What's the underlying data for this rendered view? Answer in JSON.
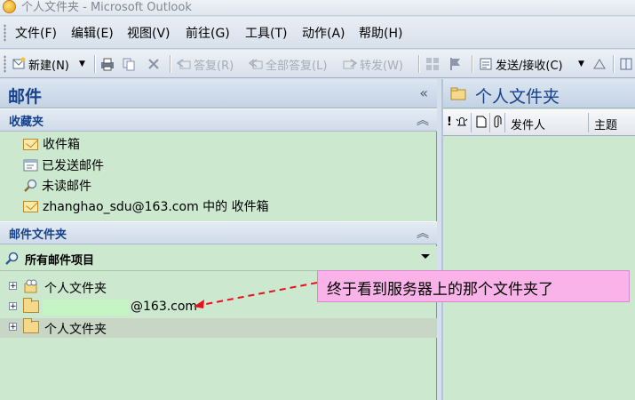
{
  "window": {
    "title": "个人文件夹 - Microsoft Outlook"
  },
  "menu": [
    "文件(F)",
    "编辑(E)",
    "视图(V)",
    "前往(G)",
    "工具(T)",
    "动作(A)",
    "帮助(H)"
  ],
  "toolbar": {
    "new": "新建(N)",
    "reply": "答复(R)",
    "reply_all": "全部答复(L)",
    "forward": "转发(W)",
    "send_receive": "发送/接收(C)"
  },
  "left_pane": {
    "title": "邮件",
    "favorites_title": "收藏夹",
    "favorites": [
      "收件箱",
      "已发送邮件",
      "未读邮件",
      "zhanghao_sdu@163.com 中的 收件箱"
    ],
    "mail_folders_title": "邮件文件夹",
    "all_items": "所有邮件项目",
    "tree": [
      "个人文件夹",
      "@163.com",
      "个人文件夹"
    ]
  },
  "right_pane": {
    "title": "个人文件夹",
    "columns": [
      "!",
      "发件人",
      "主题"
    ]
  },
  "annotation": {
    "text": "终于看到服务器上的那个文件夹了"
  }
}
